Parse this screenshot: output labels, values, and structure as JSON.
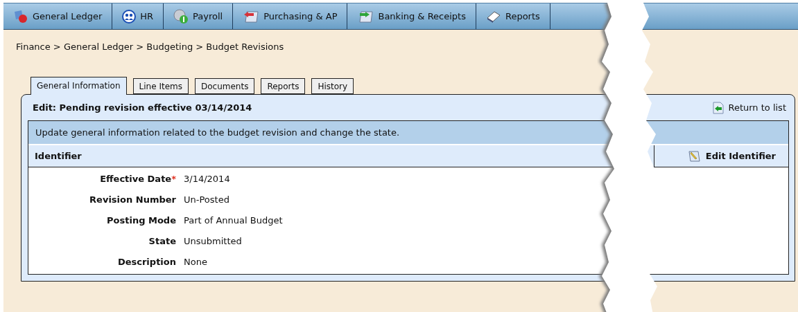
{
  "nav": [
    {
      "label": "General Ledger"
    },
    {
      "label": "HR"
    },
    {
      "label": "Payroll"
    },
    {
      "label": "Purchasing & AP"
    },
    {
      "label": "Banking & Receipts"
    },
    {
      "label": "Reports"
    }
  ],
  "breadcrumb": "Finance > General Ledger > Budgeting > Budget Revisions",
  "tabs": [
    {
      "label": "General Information",
      "selected": true
    },
    {
      "label": "Line Items",
      "selected": false
    },
    {
      "label": "Documents",
      "selected": false
    },
    {
      "label": "Reports",
      "selected": false
    },
    {
      "label": "History",
      "selected": false
    }
  ],
  "panel": {
    "title": "Edit: Pending revision effective 03/14/2014",
    "return_link": "Return to list",
    "description": "Update general information related to the budget revision and change the state.",
    "section": "Identifier",
    "section_button": "Edit Identifier",
    "fields": [
      {
        "label": "Effective Date",
        "required_mark": "*",
        "value": "3/14/2014"
      },
      {
        "label": "Revision Number",
        "value": "Un-Posted"
      },
      {
        "label": "Posting Mode",
        "value": "Part of Annual Budget"
      },
      {
        "label": "State",
        "value": "Unsubmitted"
      },
      {
        "label": "Description",
        "value": "None"
      }
    ]
  }
}
